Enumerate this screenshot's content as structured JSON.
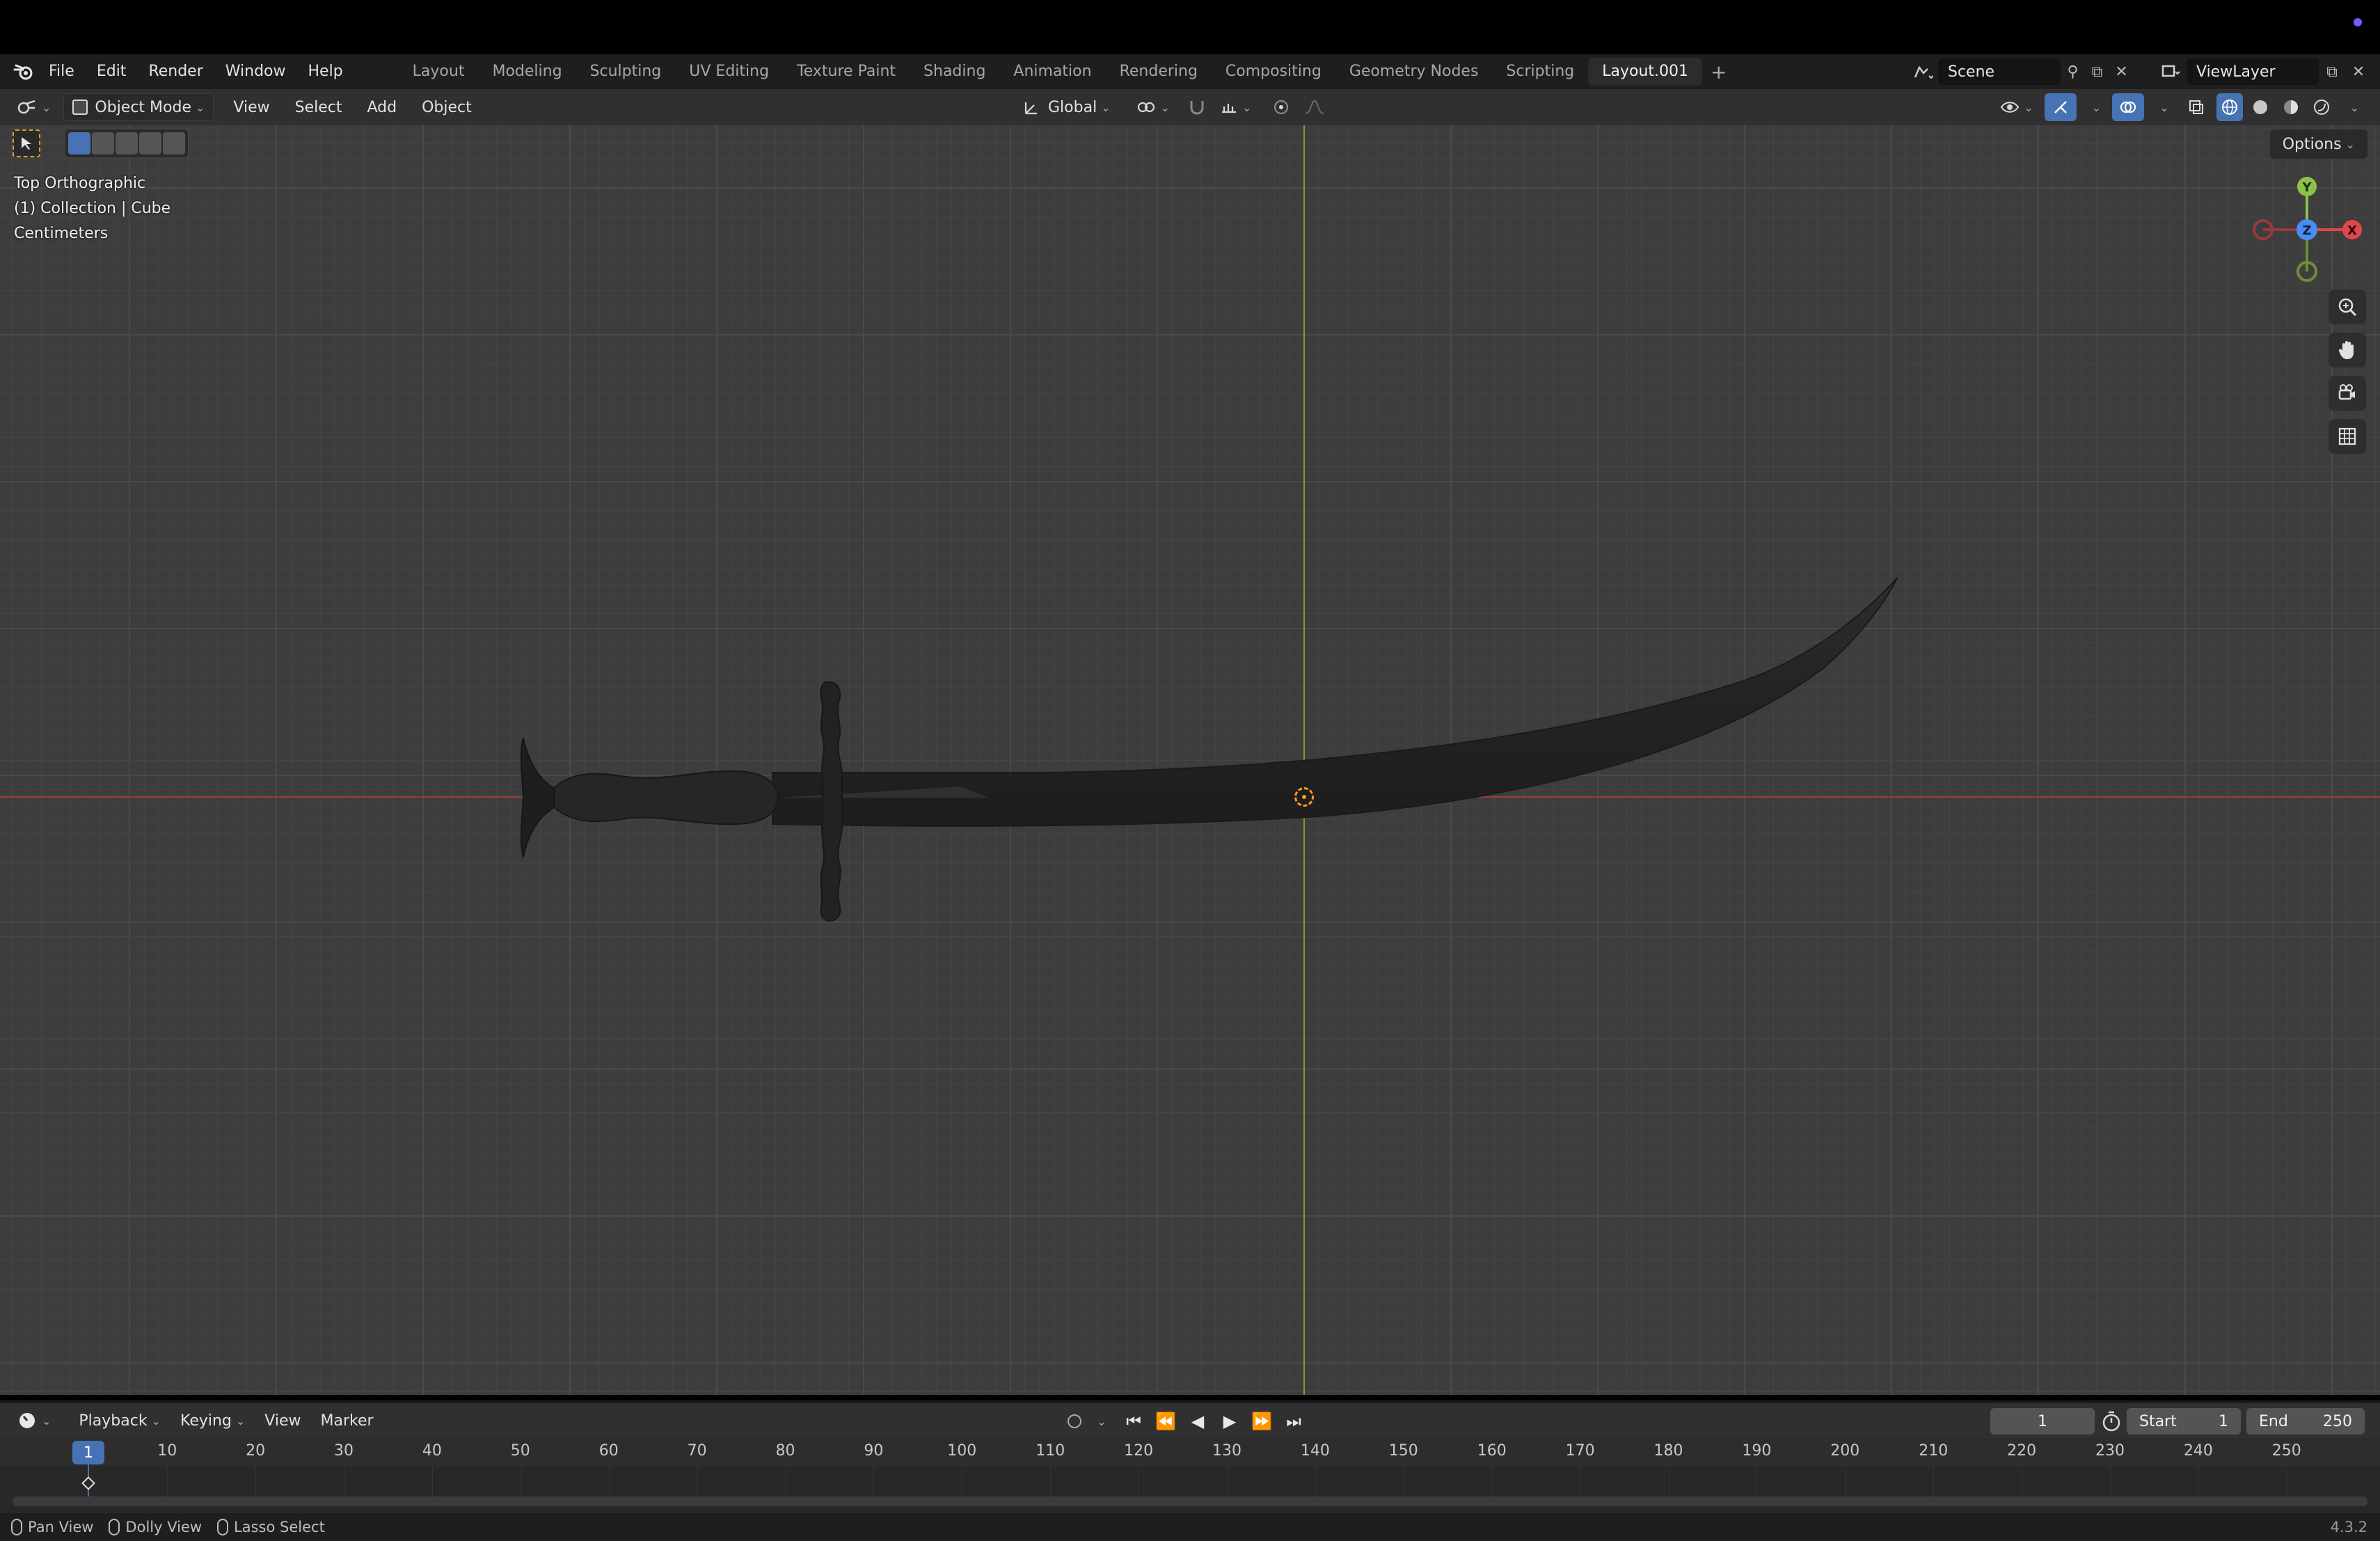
{
  "app": {
    "menus": [
      "File",
      "Edit",
      "Render",
      "Window",
      "Help"
    ],
    "workspaces": [
      "Layout",
      "Modeling",
      "Sculpting",
      "UV Editing",
      "Texture Paint",
      "Shading",
      "Animation",
      "Rendering",
      "Compositing",
      "Geometry Nodes",
      "Scripting",
      "Layout.001"
    ],
    "active_workspace": "Layout.001",
    "scene": "Scene",
    "view_layer": "ViewLayer"
  },
  "viewport_header": {
    "mode": "Object Mode",
    "menus": [
      "View",
      "Select",
      "Add",
      "Object"
    ],
    "orientation": "Global",
    "options_label": "Options"
  },
  "viewport": {
    "view_name": "Top Orthographic",
    "collection_info": "(1) Collection | Cube",
    "units": "Centimeters",
    "gizmo": {
      "y": "Y",
      "z": "Z",
      "x": "X"
    },
    "colors": {
      "x_axis": "#e0474c",
      "y_axis": "#8bc34a",
      "z_axis": "#4a8cf0",
      "origin": "#ff9a1f"
    }
  },
  "timeline": {
    "menus": [
      "Playback",
      "Keying",
      "View",
      "Marker"
    ],
    "current_frame": "1",
    "start_label": "Start",
    "start_value": "1",
    "end_label": "End",
    "end_value": "250",
    "ruler_labels": [
      "10",
      "20",
      "30",
      "40",
      "50",
      "60",
      "70",
      "80",
      "90",
      "100",
      "110",
      "120",
      "130",
      "140",
      "150",
      "160",
      "170",
      "180",
      "190",
      "200",
      "210",
      "220",
      "230",
      "240",
      "250"
    ],
    "playhead": "1"
  },
  "statusbar": {
    "items": [
      "Pan View",
      "Dolly View",
      "Lasso Select"
    ],
    "version": "4.3.2"
  }
}
